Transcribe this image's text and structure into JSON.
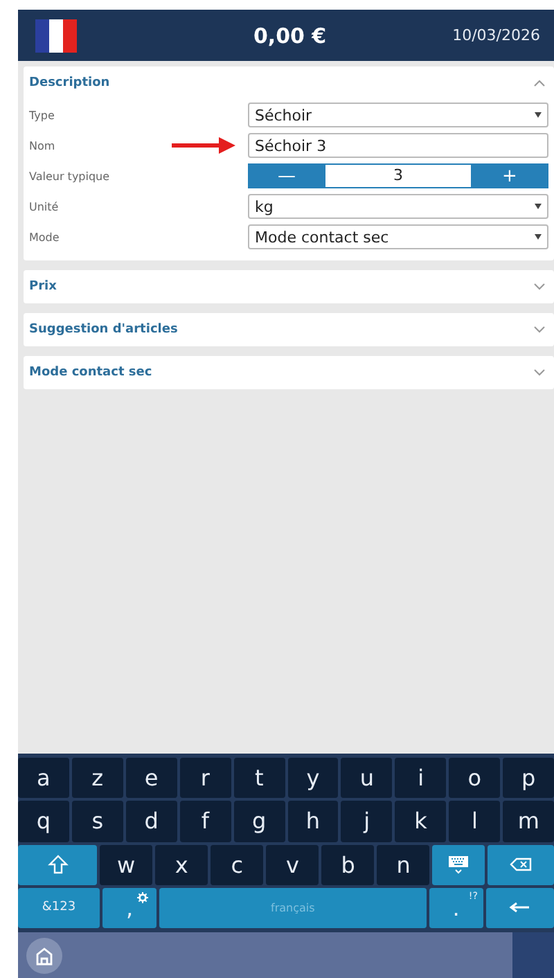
{
  "header": {
    "amount": "0,00 €",
    "date": "10/03/2026"
  },
  "sections": [
    {
      "title": "Description",
      "expanded": true,
      "fields": [
        {
          "kind": "select",
          "label": "Type",
          "value": "Séchoir"
        },
        {
          "kind": "text",
          "label": "Nom",
          "value": "Séchoir 3",
          "pointed": true
        },
        {
          "kind": "stepper",
          "label": "Valeur typique",
          "minus": "—",
          "value": "3",
          "plus": "+"
        },
        {
          "kind": "select",
          "label": "Unité",
          "value": "kg"
        },
        {
          "kind": "select",
          "label": "Mode",
          "value": "Mode contact sec"
        }
      ]
    },
    {
      "title": "Prix",
      "expanded": false
    },
    {
      "title": "Suggestion d'articles",
      "expanded": false
    },
    {
      "title": "Mode contact sec",
      "expanded": false
    }
  ],
  "keyboard": {
    "letter_row": [
      {
        "kind": "char",
        "label": "a"
      },
      {
        "kind": "char",
        "label": "z"
      },
      {
        "kind": "char",
        "label": "e"
      },
      {
        "kind": "char",
        "label": "r"
      },
      {
        "kind": "char",
        "label": "t"
      },
      {
        "kind": "char",
        "label": "y"
      },
      {
        "kind": "char",
        "label": "u"
      },
      {
        "kind": "char",
        "label": "i"
      },
      {
        "kind": "char",
        "label": "o"
      },
      {
        "kind": "char",
        "label": "p"
      }
    ],
    "home_row": [
      {
        "kind": "char",
        "label": "q"
      },
      {
        "kind": "char",
        "label": "s"
      },
      {
        "kind": "char",
        "label": "d"
      },
      {
        "kind": "char",
        "label": "f"
      },
      {
        "kind": "char",
        "label": "g"
      },
      {
        "kind": "char",
        "label": "h"
      },
      {
        "kind": "char",
        "label": "j"
      },
      {
        "kind": "char",
        "label": "k"
      },
      {
        "kind": "char",
        "label": "l"
      },
      {
        "kind": "char",
        "label": "m"
      }
    ],
    "lower_row": [
      {
        "kind": "shift"
      },
      {
        "kind": "char",
        "label": "w"
      },
      {
        "kind": "char",
        "label": "x"
      },
      {
        "kind": "char",
        "label": "c"
      },
      {
        "kind": "char",
        "label": "v"
      },
      {
        "kind": "char",
        "label": "b"
      },
      {
        "kind": "char",
        "label": "n"
      },
      {
        "kind": "hide"
      },
      {
        "kind": "backspace"
      }
    ],
    "function_row": [
      {
        "kind": "symbols",
        "label": "&123"
      },
      {
        "kind": "comma",
        "label": ","
      },
      {
        "kind": "space",
        "label": "français"
      },
      {
        "kind": "period",
        "label": ".",
        "sub": "!?"
      },
      {
        "kind": "enter"
      }
    ]
  }
}
